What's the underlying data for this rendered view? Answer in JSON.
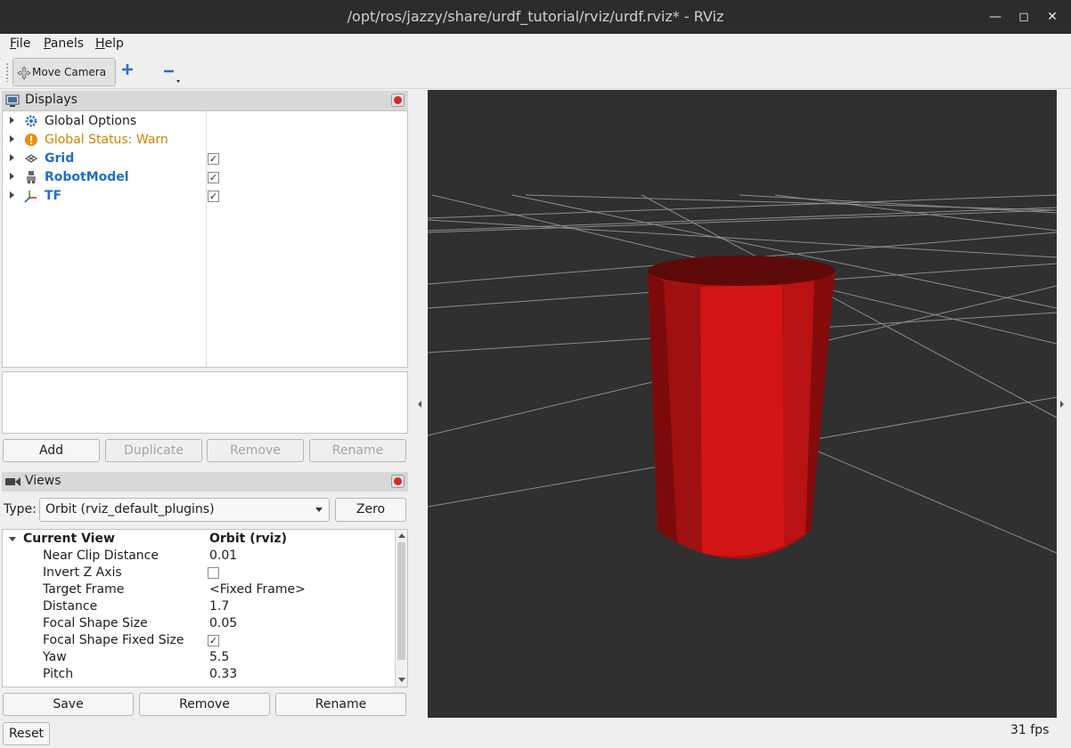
{
  "window": {
    "title": "/opt/ros/jazzy/share/urdf_tutorial/rviz/urdf.rviz* - RViz"
  },
  "menu": {
    "file": "File",
    "panels": "Panels",
    "help": "Help"
  },
  "toolbar": {
    "move_camera": "Move Camera"
  },
  "displays": {
    "title": "Displays",
    "items": [
      {
        "label": "Global Options",
        "icon": "gear-icon"
      },
      {
        "label": "Global Status: Warn",
        "icon": "warning-icon"
      },
      {
        "label": "Grid",
        "icon": "grid-icon",
        "checked": true
      },
      {
        "label": "RobotModel",
        "icon": "robot-icon",
        "checked": true
      },
      {
        "label": "TF",
        "icon": "tf-axes-icon",
        "checked": true
      }
    ],
    "buttons": {
      "add": "Add",
      "duplicate": "Duplicate",
      "remove": "Remove",
      "rename": "Rename"
    }
  },
  "views": {
    "title": "Views",
    "type_label": "Type:",
    "type_value": "Orbit (rviz_default_plugins)",
    "zero": "Zero",
    "current_view": "Current View",
    "current_view_value": "Orbit (rviz)",
    "properties": [
      {
        "name": "Near Clip Distance",
        "value": "0.01"
      },
      {
        "name": "Invert Z Axis",
        "value": "",
        "checkbox": false
      },
      {
        "name": "Target Frame",
        "value": "<Fixed Frame>"
      },
      {
        "name": "Distance",
        "value": "1.7"
      },
      {
        "name": "Focal Shape Size",
        "value": "0.05"
      },
      {
        "name": "Focal Shape Fixed Size",
        "value": "",
        "checkbox": true
      },
      {
        "name": "Yaw",
        "value": "5.5"
      },
      {
        "name": "Pitch",
        "value": "0.33"
      }
    ],
    "buttons": {
      "save": "Save",
      "remove": "Remove",
      "rename": "Rename"
    }
  },
  "status": {
    "reset": "Reset",
    "fps": "31 fps"
  },
  "colors": {
    "cylinder": "#d01010",
    "viewport_bg": "#303030",
    "grid": "#a0a0a0",
    "link_blue": "#1e6ec8",
    "warn": "#cc8400"
  }
}
